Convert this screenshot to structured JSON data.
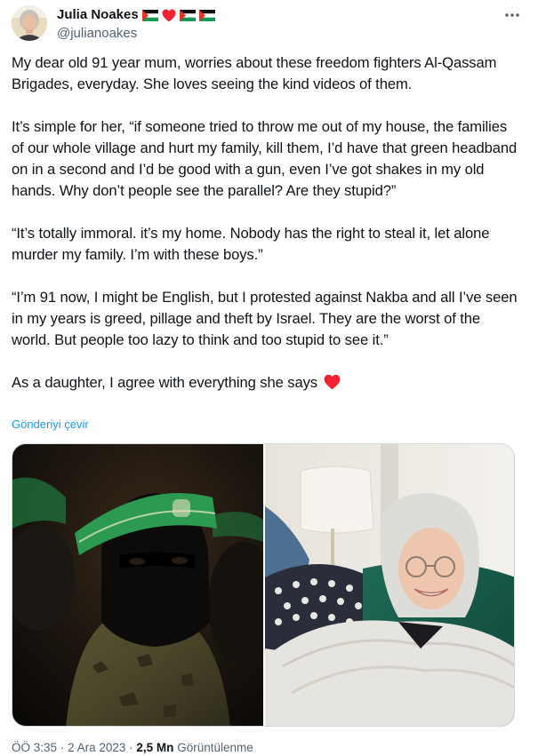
{
  "author": {
    "display_name": "Julia Noakes",
    "handle": "@julianoakes",
    "name_emojis": [
      "palestine-flag",
      "red-heart",
      "palestine-flag",
      "palestine-flag"
    ]
  },
  "tweet": {
    "paragraphs": [
      "My dear old 91 year mum, worries about these freedom fighters Al-Qassam Brigades, everyday. She loves seeing the kind videos of them.",
      "It’s simple for her, “if someone tried to throw me out of my house, the families of  our whole village  and hurt my family, kill them, I’d have that green headband on in a second and I’d be good with a gun, even I’ve got shakes in my old hands. Why don’t people see the parallel? Are they stupid?”",
      "“It’s totally immoral. it’s my home. Nobody has the right to steal it, let alone murder my family. I’m with these boys.”",
      "“I’m 91 now, I might be English, but I protested  against Nakba and all I’ve seen in my years is greed, pillage and theft by Israel. They are the worst of the world. But people too lazy to think and too stupid to see it.”"
    ],
    "closing_line": "As a daughter, I agree with everything she says",
    "closing_emoji": "red-heart",
    "translate_label": "Gönderiyi çevir"
  },
  "media": {
    "left_image": "photo-masked-fighter-green-headband",
    "right_image": "photo-smiling-elderly-woman-on-sofa"
  },
  "meta": {
    "time": "ÖÖ 3:35",
    "separator": "·",
    "date": "2 Ara 2023",
    "views_count": "2,5 Mn",
    "views_label": "Görüntülenme"
  },
  "colors": {
    "text_primary": "#0f1419",
    "text_secondary": "#536471",
    "link": "#1d9bf0",
    "border": "#cfd9de",
    "heart": "#f4212e"
  }
}
